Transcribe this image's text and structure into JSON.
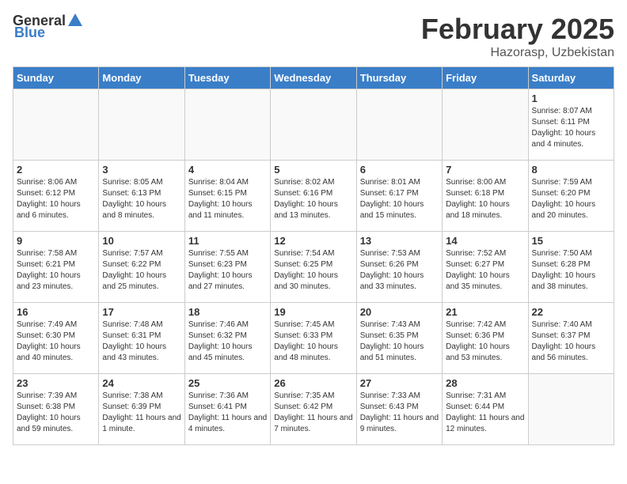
{
  "header": {
    "logo_general": "General",
    "logo_blue": "Blue",
    "title": "February 2025",
    "subtitle": "Hazorasp, Uzbekistan"
  },
  "days_of_week": [
    "Sunday",
    "Monday",
    "Tuesday",
    "Wednesday",
    "Thursday",
    "Friday",
    "Saturday"
  ],
  "weeks": [
    [
      {
        "day": "",
        "info": ""
      },
      {
        "day": "",
        "info": ""
      },
      {
        "day": "",
        "info": ""
      },
      {
        "day": "",
        "info": ""
      },
      {
        "day": "",
        "info": ""
      },
      {
        "day": "",
        "info": ""
      },
      {
        "day": "1",
        "info": "Sunrise: 8:07 AM\nSunset: 6:11 PM\nDaylight: 10 hours\nand 4 minutes."
      }
    ],
    [
      {
        "day": "2",
        "info": "Sunrise: 8:06 AM\nSunset: 6:12 PM\nDaylight: 10 hours\nand 6 minutes."
      },
      {
        "day": "3",
        "info": "Sunrise: 8:05 AM\nSunset: 6:13 PM\nDaylight: 10 hours\nand 8 minutes."
      },
      {
        "day": "4",
        "info": "Sunrise: 8:04 AM\nSunset: 6:15 PM\nDaylight: 10 hours\nand 11 minutes."
      },
      {
        "day": "5",
        "info": "Sunrise: 8:02 AM\nSunset: 6:16 PM\nDaylight: 10 hours\nand 13 minutes."
      },
      {
        "day": "6",
        "info": "Sunrise: 8:01 AM\nSunset: 6:17 PM\nDaylight: 10 hours\nand 15 minutes."
      },
      {
        "day": "7",
        "info": "Sunrise: 8:00 AM\nSunset: 6:18 PM\nDaylight: 10 hours\nand 18 minutes."
      },
      {
        "day": "8",
        "info": "Sunrise: 7:59 AM\nSunset: 6:20 PM\nDaylight: 10 hours\nand 20 minutes."
      }
    ],
    [
      {
        "day": "9",
        "info": "Sunrise: 7:58 AM\nSunset: 6:21 PM\nDaylight: 10 hours\nand 23 minutes."
      },
      {
        "day": "10",
        "info": "Sunrise: 7:57 AM\nSunset: 6:22 PM\nDaylight: 10 hours\nand 25 minutes."
      },
      {
        "day": "11",
        "info": "Sunrise: 7:55 AM\nSunset: 6:23 PM\nDaylight: 10 hours\nand 27 minutes."
      },
      {
        "day": "12",
        "info": "Sunrise: 7:54 AM\nSunset: 6:25 PM\nDaylight: 10 hours\nand 30 minutes."
      },
      {
        "day": "13",
        "info": "Sunrise: 7:53 AM\nSunset: 6:26 PM\nDaylight: 10 hours\nand 33 minutes."
      },
      {
        "day": "14",
        "info": "Sunrise: 7:52 AM\nSunset: 6:27 PM\nDaylight: 10 hours\nand 35 minutes."
      },
      {
        "day": "15",
        "info": "Sunrise: 7:50 AM\nSunset: 6:28 PM\nDaylight: 10 hours\nand 38 minutes."
      }
    ],
    [
      {
        "day": "16",
        "info": "Sunrise: 7:49 AM\nSunset: 6:30 PM\nDaylight: 10 hours\nand 40 minutes."
      },
      {
        "day": "17",
        "info": "Sunrise: 7:48 AM\nSunset: 6:31 PM\nDaylight: 10 hours\nand 43 minutes."
      },
      {
        "day": "18",
        "info": "Sunrise: 7:46 AM\nSunset: 6:32 PM\nDaylight: 10 hours\nand 45 minutes."
      },
      {
        "day": "19",
        "info": "Sunrise: 7:45 AM\nSunset: 6:33 PM\nDaylight: 10 hours\nand 48 minutes."
      },
      {
        "day": "20",
        "info": "Sunrise: 7:43 AM\nSunset: 6:35 PM\nDaylight: 10 hours\nand 51 minutes."
      },
      {
        "day": "21",
        "info": "Sunrise: 7:42 AM\nSunset: 6:36 PM\nDaylight: 10 hours\nand 53 minutes."
      },
      {
        "day": "22",
        "info": "Sunrise: 7:40 AM\nSunset: 6:37 PM\nDaylight: 10 hours\nand 56 minutes."
      }
    ],
    [
      {
        "day": "23",
        "info": "Sunrise: 7:39 AM\nSunset: 6:38 PM\nDaylight: 10 hours\nand 59 minutes."
      },
      {
        "day": "24",
        "info": "Sunrise: 7:38 AM\nSunset: 6:39 PM\nDaylight: 11 hours\nand 1 minute."
      },
      {
        "day": "25",
        "info": "Sunrise: 7:36 AM\nSunset: 6:41 PM\nDaylight: 11 hours\nand 4 minutes."
      },
      {
        "day": "26",
        "info": "Sunrise: 7:35 AM\nSunset: 6:42 PM\nDaylight: 11 hours\nand 7 minutes."
      },
      {
        "day": "27",
        "info": "Sunrise: 7:33 AM\nSunset: 6:43 PM\nDaylight: 11 hours\nand 9 minutes."
      },
      {
        "day": "28",
        "info": "Sunrise: 7:31 AM\nSunset: 6:44 PM\nDaylight: 11 hours\nand 12 minutes."
      },
      {
        "day": "",
        "info": ""
      }
    ]
  ]
}
